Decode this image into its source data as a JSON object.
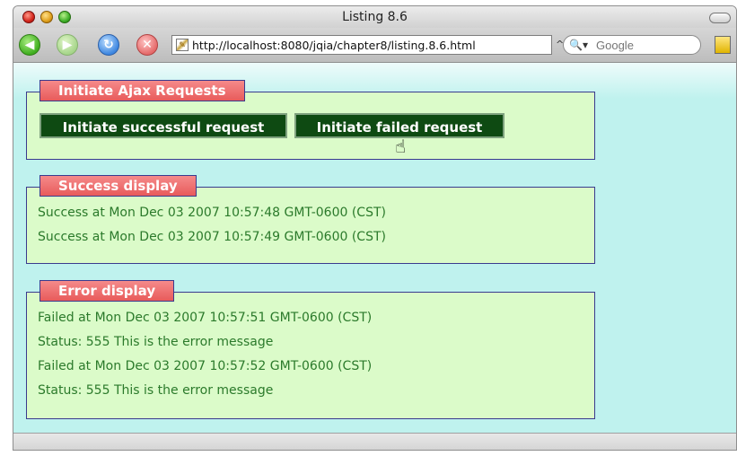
{
  "window": {
    "title": "Listing 8.6"
  },
  "toolbar": {
    "back_icon": "back-arrow-icon",
    "forward_icon": "forward-arrow-icon",
    "reload_icon": "reload-icon",
    "stop_icon": "stop-icon",
    "url": "http://localhost:8080/jqia/chapter8/listing.8.6.html",
    "search_placeholder": "Google",
    "bookmark_icon": "bookmark-icon"
  },
  "ajax_requests": {
    "legend": "Initiate Ajax Requests",
    "success_button": "Initiate successful request",
    "failed_button": "Initiate failed request"
  },
  "success_display": {
    "legend": "Success display",
    "messages": [
      "Success at Mon Dec 03 2007 10:57:48 GMT-0600 (CST)",
      "Success at Mon Dec 03 2007 10:57:49 GMT-0600 (CST)"
    ]
  },
  "error_display": {
    "legend": "Error display",
    "messages": [
      "Failed at Mon Dec 03 2007 10:57:51 GMT-0600 (CST)",
      "Status: 555 This is the error message",
      "Failed at Mon Dec 03 2007 10:57:52 GMT-0600 (CST)",
      "Status: 555 This is the error message"
    ]
  },
  "colors": {
    "page_background": "#bff2ee",
    "fieldset_background": "#dbfbc9",
    "legend_background": "#e85b5b",
    "button_background": "#0e4a12",
    "message_text": "#2b7a2b"
  }
}
